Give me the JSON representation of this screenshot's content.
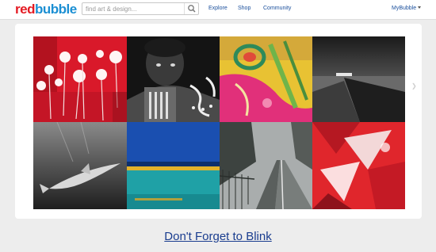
{
  "header": {
    "logo_part1": "red",
    "logo_part2": "bubble",
    "search_placeholder": "find art & design...",
    "nav": {
      "explore": "Explore",
      "shop": "Shop",
      "community": "Community"
    },
    "account_label": "MyBubble"
  },
  "artwork": {
    "title": "Don't Forget to Blink",
    "thumbnails": [
      {
        "name": "thumb-red-white-flowers"
      },
      {
        "name": "thumb-portrait-painted-man"
      },
      {
        "name": "thumb-abstract-yellow-pink"
      },
      {
        "name": "thumb-bw-seascape-path"
      },
      {
        "name": "thumb-bw-shark"
      },
      {
        "name": "thumb-blue-pool"
      },
      {
        "name": "thumb-foggy-road"
      },
      {
        "name": "thumb-red-abstract"
      }
    ]
  },
  "colors": {
    "brand_red": "#e41b23",
    "brand_blue": "#1b8fd3",
    "link_blue": "#1a3d8f",
    "page_background": "#ededed"
  }
}
